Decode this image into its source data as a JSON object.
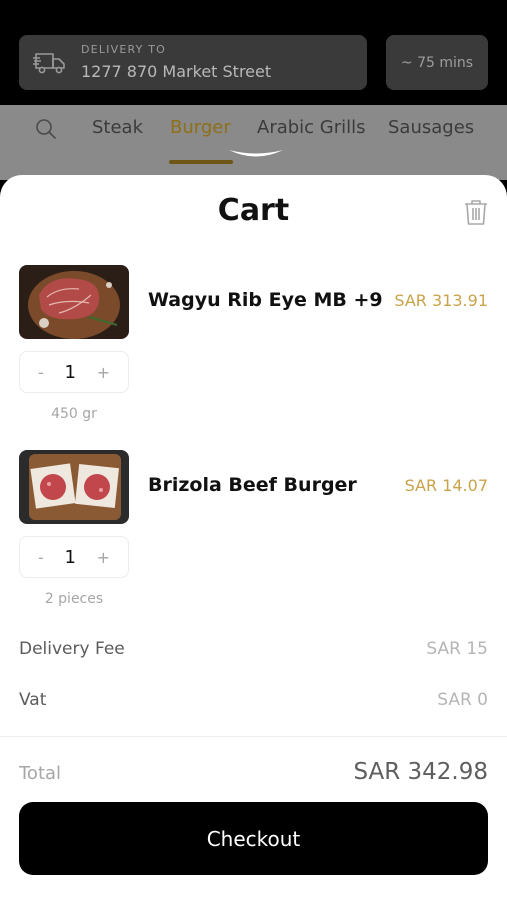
{
  "header": {
    "delivery_label": "DELIVERY TO",
    "delivery_address": "1277 870 Market Street",
    "delivery_time": "~ 75 mins"
  },
  "categories": {
    "items": [
      {
        "label": "Steak"
      },
      {
        "label": "Burger",
        "active": true
      },
      {
        "label": "Arabic Grills"
      },
      {
        "label": "Sausages"
      }
    ]
  },
  "cart": {
    "title": "Cart",
    "items": [
      {
        "name": "Wagyu Rib Eye MB +9",
        "price": "SAR 313.91",
        "qty": "1",
        "unit": "450 gr",
        "minus": "-",
        "plus": "+"
      },
      {
        "name": "Brizola Beef Burger",
        "price": "SAR 14.07",
        "qty": "1",
        "unit": "2 pieces",
        "minus": "-",
        "plus": "+"
      }
    ],
    "fees": [
      {
        "label": "Delivery Fee",
        "value": "SAR 15"
      },
      {
        "label": "Vat",
        "value": "SAR 0"
      }
    ],
    "total_label": "Total",
    "total_value": "SAR 342.98",
    "checkout_label": "Checkout"
  },
  "colors": {
    "accent_gold": "#c9a34a",
    "active_category": "#8f6f17",
    "checkout_bg": "#000000"
  }
}
